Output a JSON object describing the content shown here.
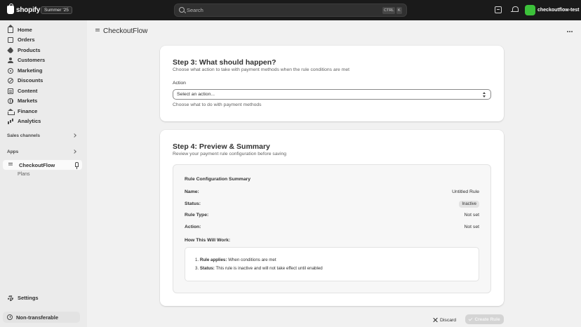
{
  "topbar": {
    "brand": "shopify",
    "edition_badge": "Summer '25",
    "search_placeholder": "Search",
    "shortcut_ctrl": "CTRL",
    "shortcut_key": "K",
    "store_name": "checkoutflow-test",
    "avatar_color": "#3cc13a"
  },
  "sidebar": {
    "items": [
      {
        "label": "Home",
        "icon": "home-icon"
      },
      {
        "label": "Orders",
        "icon": "orders-icon"
      },
      {
        "label": "Products",
        "icon": "tag-icon"
      },
      {
        "label": "Customers",
        "icon": "person-icon"
      },
      {
        "label": "Marketing",
        "icon": "target-icon"
      },
      {
        "label": "Discounts",
        "icon": "discount-icon"
      },
      {
        "label": "Content",
        "icon": "content-icon"
      },
      {
        "label": "Markets",
        "icon": "globe-icon"
      },
      {
        "label": "Finance",
        "icon": "bank-icon"
      },
      {
        "label": "Analytics",
        "icon": "chart-icon"
      }
    ],
    "sales_channels": "Sales channels",
    "apps": "Apps",
    "app_name": "CheckoutFlow",
    "app_sub": "Plans",
    "settings": "Settings",
    "non_transferable": "Non-transferable"
  },
  "page": {
    "title": "CheckoutFlow"
  },
  "step3": {
    "title": "Step 3: What should happen?",
    "description": "Choose what action to take with payment methods when the rule conditions are met",
    "action_label": "Action",
    "action_value": "Select an action...",
    "action_help": "Choose what to do with payment methods"
  },
  "step4": {
    "title": "Step 4: Preview & Summary",
    "description": "Review your payment rule configuration before saving",
    "summary_title": "Rule Configuration Summary",
    "rows": [
      {
        "label": "Name:",
        "value": "Untitled Rule"
      },
      {
        "label": "Status:",
        "value": "Inactive"
      },
      {
        "label": "Rule Type:",
        "value": "Not set"
      },
      {
        "label": "Action:",
        "value": "Not set"
      }
    ],
    "how_title": "How This Will Work:",
    "how_lines": [
      {
        "prefix": "1. ",
        "bold": "Rule applies:",
        "text": " When conditions are met"
      },
      {
        "prefix": "3. ",
        "bold": "Status:",
        "text": " This rule is inactive and will not take effect until enabled"
      }
    ]
  },
  "footer": {
    "discard": "Discard",
    "create": "Create Rule"
  }
}
